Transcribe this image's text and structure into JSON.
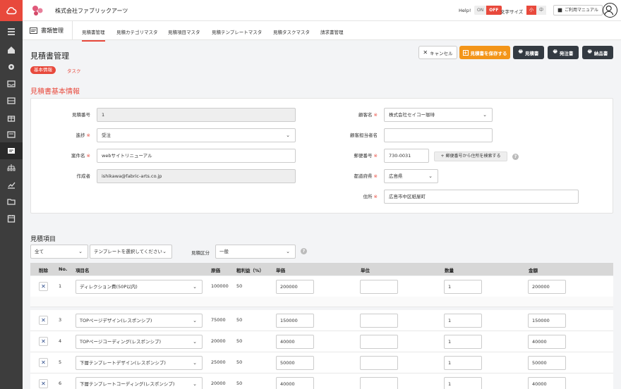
{
  "header": {
    "company": "株式会社ファブリックアーツ",
    "help": "Help!",
    "on": "ON",
    "off": "OFF",
    "font_size_label": "文字サイズ",
    "font_small": "小",
    "font_medium": "中",
    "manual": "ご利用マニュアル"
  },
  "subnav": {
    "section": "書類管理",
    "tabs": [
      "見積書管理",
      "見積カテゴリマスタ",
      "見積項目マスタ",
      "見積テンプレートマスタ",
      "見積タスクマスタ",
      "請求書管理"
    ]
  },
  "page": {
    "title": "見積書管理",
    "pill": "基本情報",
    "pill_link": "タスク",
    "section_title": "見積書基本情報",
    "buttons": {
      "cancel": "キャンセル",
      "save": "見積書を保存する",
      "estimate": "見積書",
      "order": "発注書",
      "delivery": "納品書"
    }
  },
  "form": {
    "estimate_no": {
      "label": "見積番号",
      "value": "1"
    },
    "progress": {
      "label": "進捗",
      "value": "受注"
    },
    "project": {
      "label": "案件名",
      "value": "webサイトリニューアル"
    },
    "creator": {
      "label": "作成者",
      "value": "ishikawa@fabric-arts.co.jp"
    },
    "customer": {
      "label": "顧客名",
      "value": "株式会社セイコー珈琲"
    },
    "contact": {
      "label": "顧客担当者名",
      "value": ""
    },
    "zip": {
      "label": "郵便番号",
      "value": "730-0031",
      "search": "郵便番号から住所を検索する"
    },
    "pref": {
      "label": "都道府県",
      "value": "広島県"
    },
    "address": {
      "label": "住所",
      "value": "広島市中区紙屋町"
    },
    "required": "※"
  },
  "estimate": {
    "title": "見積項目",
    "filter_all": "全て",
    "template_placeholder": "テンプレートを選択してください",
    "kubun_label": "見積区分",
    "kubun_value": "一般",
    "columns": [
      "削除",
      "No.",
      "項目名",
      "原価",
      "粗利益（%）",
      "単価",
      "単位",
      "数量",
      "金額"
    ],
    "rows": [
      {
        "no": "1",
        "name": "ディレクション費(50P以内)",
        "cost": "100000",
        "margin": "50",
        "price": "200000",
        "unit": "",
        "qty": "1",
        "amount": "200000"
      },
      {
        "no": "3",
        "name": "TOPページデザイン(レスポンシブ)",
        "cost": "75000",
        "margin": "50",
        "price": "150000",
        "unit": "",
        "qty": "1",
        "amount": "150000"
      },
      {
        "no": "4",
        "name": "TOPページコーディング(レスポンシブ)",
        "cost": "20000",
        "margin": "50",
        "price": "40000",
        "unit": "",
        "qty": "1",
        "amount": "40000"
      },
      {
        "no": "5",
        "name": "下層テンプレートデザイン(レスポンシブ)",
        "cost": "25000",
        "margin": "50",
        "price": "50000",
        "unit": "",
        "qty": "1",
        "amount": "50000"
      },
      {
        "no": "6",
        "name": "下層テンプレートコーディング(レスポンシブ)",
        "cost": "20000",
        "margin": "50",
        "price": "40000",
        "unit": "",
        "qty": "1",
        "amount": "40000"
      }
    ]
  },
  "colors": {
    "accent": "#e8493c",
    "orange": "#f39519",
    "dark": "#333a42",
    "sidebar": "#3d3d3d"
  }
}
